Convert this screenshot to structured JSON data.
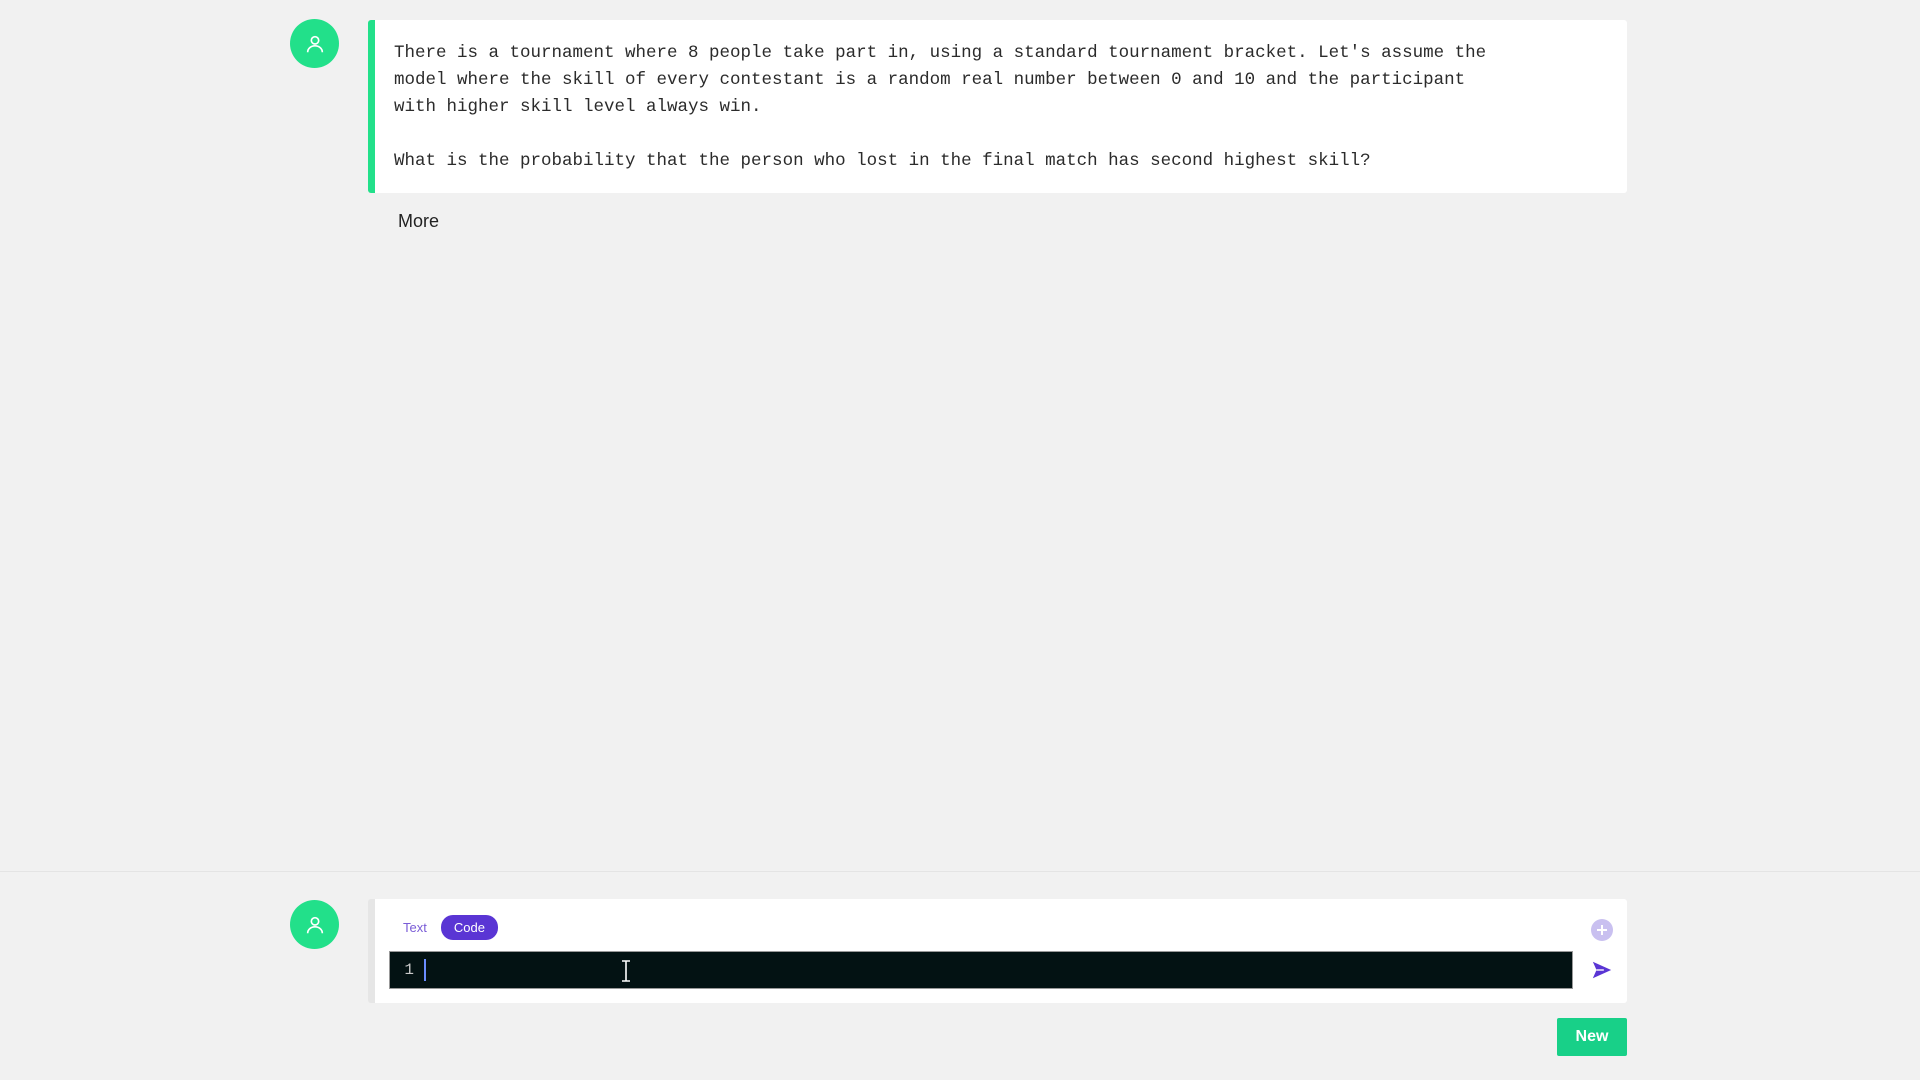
{
  "message": {
    "text": "There is a tournament where 8 people take part in, using a standard tournament bracket. Let's assume the\nmodel where the skill of every contestant is a random real number between 0 and 10 and the participant\nwith higher skill level always win.\n\nWhat is the probability that the person who lost in the final match has second highest skill?",
    "more_label": "More"
  },
  "composer": {
    "tabs": [
      {
        "label": "Text",
        "active": false
      },
      {
        "label": "Code",
        "active": true
      }
    ],
    "line_number": "1",
    "code_value": "",
    "add_icon": "plus-icon",
    "send_icon": "send-icon"
  },
  "footer": {
    "new_label": "New"
  },
  "colors": {
    "accent_green": "#22e08a",
    "accent_purple": "#5a35d4",
    "editor_bg": "#031213",
    "background": "#f1f1f1"
  }
}
